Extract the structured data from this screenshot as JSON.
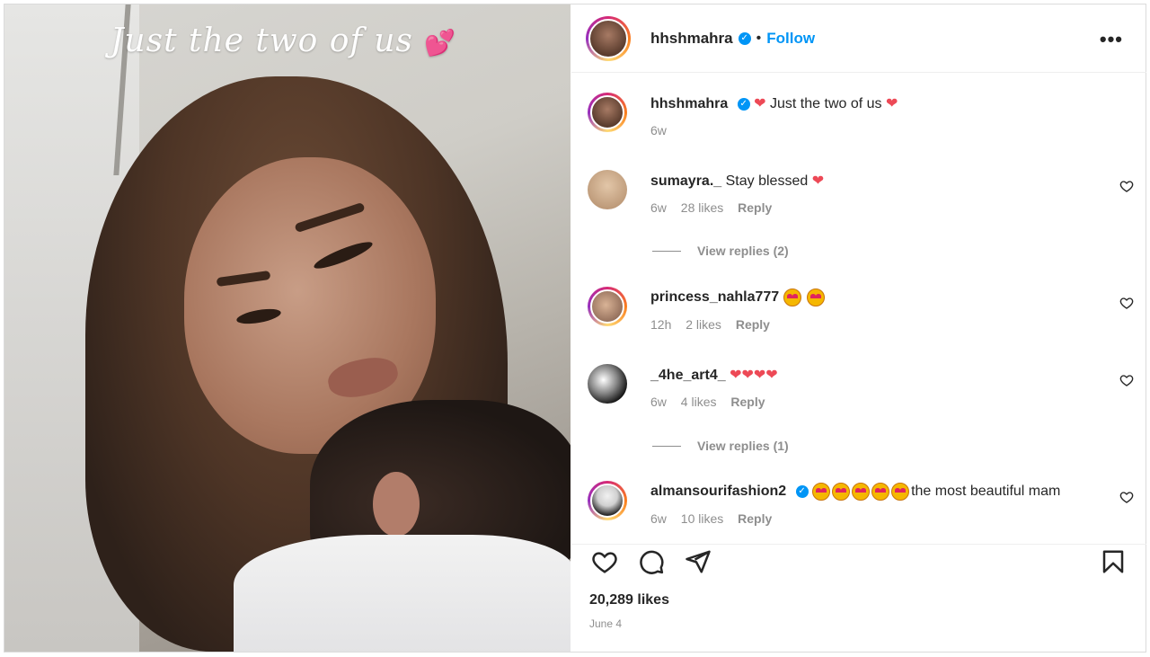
{
  "post": {
    "photo_caption": "Just the two of us",
    "photo_caption_emoji": "💕",
    "author": "hhshmahra",
    "follow_label": "Follow",
    "separator": "•",
    "more_label": "•••",
    "caption_text": "Just the two of us",
    "caption_time": "6w",
    "likes": "20,289 likes",
    "date": "June 4"
  },
  "comments": [
    {
      "user": "sumayra._",
      "text": "Stay blessed",
      "time": "6w",
      "likes": "28 likes",
      "reply": "Reply",
      "view_replies": "View replies (2)"
    },
    {
      "user": "princess_nahla777",
      "text": "",
      "time": "12h",
      "likes": "2 likes",
      "reply": "Reply"
    },
    {
      "user": "_4he_art4_",
      "text": "",
      "time": "6w",
      "likes": "4 likes",
      "reply": "Reply",
      "view_replies": "View replies (1)"
    },
    {
      "user": "almansourifashion2",
      "text": "the most beautiful mam",
      "time": "6w",
      "likes": "10 likes",
      "reply": "Reply"
    }
  ],
  "icons": {
    "like": "heart-icon",
    "comment": "comment-icon",
    "share": "share-icon",
    "save": "bookmark-icon",
    "verified": "verified-badge-icon"
  },
  "colors": {
    "link": "#0095f6",
    "heart": "#ed4956",
    "muted": "#8e8e8e"
  }
}
